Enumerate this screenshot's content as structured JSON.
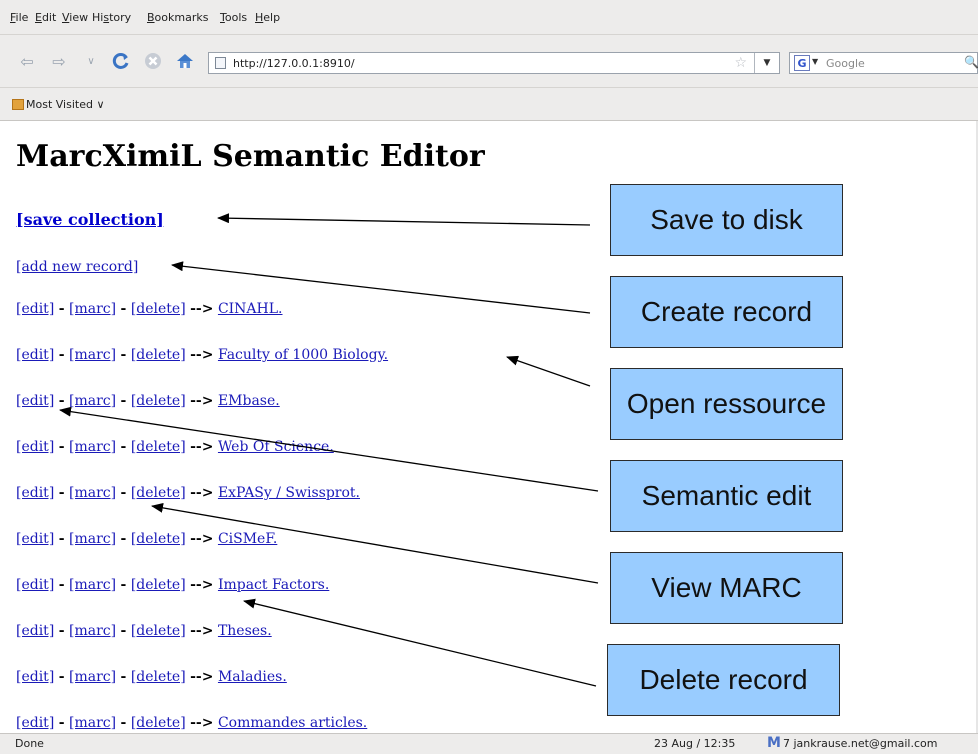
{
  "menu": [
    "File",
    "Edit",
    "View",
    "History",
    "Bookmarks",
    "Tools",
    "Help"
  ],
  "menu_access_keys": [
    "F",
    "E",
    "V",
    "s",
    "B",
    "T",
    "H"
  ],
  "toolbar": {
    "url": "http://127.0.0.1:8910/",
    "search_placeholder": "Google",
    "search_engine_icon": "G"
  },
  "bookmarks": {
    "most_visited": "Most Visited"
  },
  "page": {
    "title": "MarcXimiL Semantic Editor",
    "save_link": "[save collection]",
    "add_link": "[add new record]",
    "record_actions": {
      "edit": "[edit]",
      "marc": "[marc]",
      "delete": "[delete]",
      "dash": "-",
      "arrow": "-->"
    },
    "records": [
      "CINAHL.",
      "Faculty of 1000 Biology.",
      "EMbase.",
      "Web Of Science.",
      "ExPASy / Swissprot.",
      "CiSMeF.",
      "Impact Factors.",
      "Theses.",
      "Maladies.",
      "Commandes articles."
    ]
  },
  "annotations": [
    "Save to disk",
    "Create record",
    "Open ressource",
    "Semantic edit",
    "View MARC",
    "Delete record"
  ],
  "annotation_color": "#99ccff",
  "link_color": "#1a1ab8",
  "status": {
    "left": "Done",
    "datetime": "23 Aug / 12:35",
    "mail": "7 jankrause.net@gmail.com"
  },
  "icons": [
    "back-arrow-icon",
    "forward-arrow-icon",
    "history-dropdown-icon",
    "reload-icon",
    "stop-icon",
    "home-icon",
    "page-icon",
    "bookmark-star-icon",
    "url-dropdown-icon",
    "google-search-icon",
    "search-magnifier-icon",
    "most-visited-icon",
    "gmail-icon"
  ]
}
